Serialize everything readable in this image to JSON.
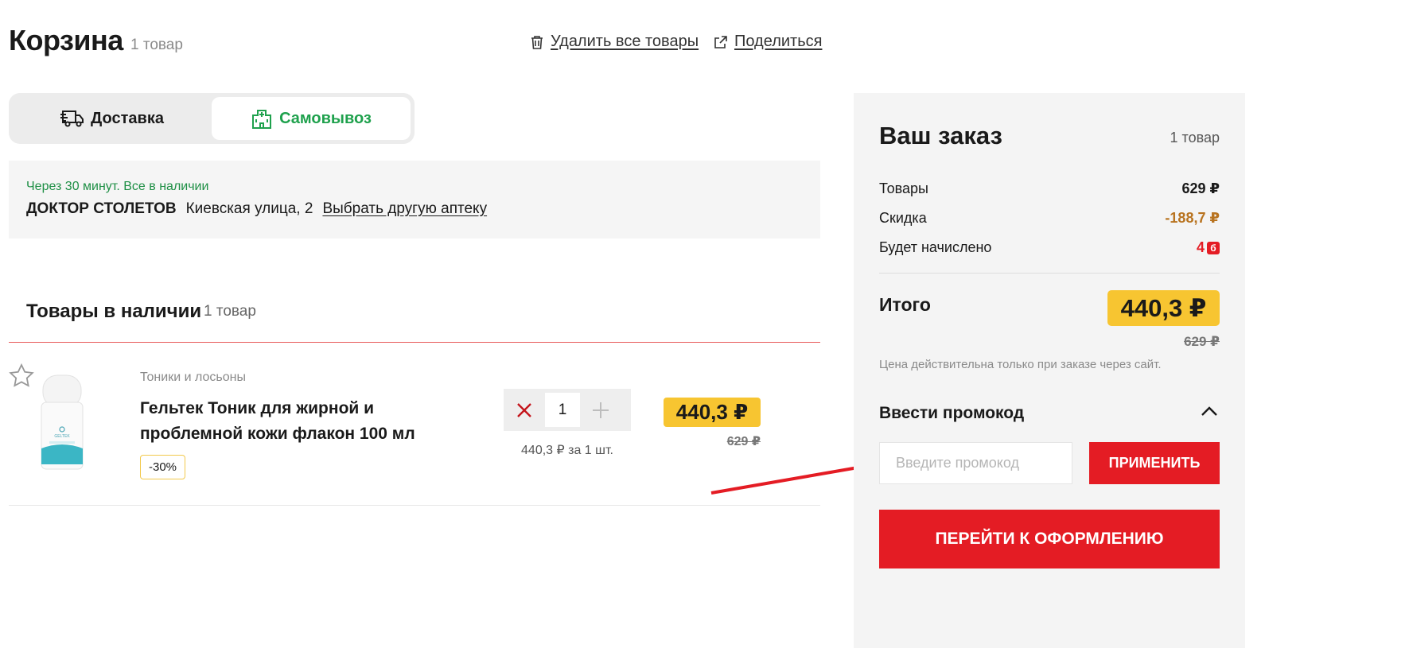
{
  "header": {
    "title": "Корзина",
    "count": "1 товар",
    "delete_all": "Удалить все товары",
    "share": "Поделиться"
  },
  "tabs": {
    "delivery": "Доставка",
    "pickup": "Самовывоз",
    "active": "pickup"
  },
  "pharmacy": {
    "note": "Через 30 минут. Все в наличии",
    "name": "ДОКТОР СТОЛЕТОВ",
    "address": "Киевская улица, 2",
    "change_link": "Выбрать другую аптеку"
  },
  "section": {
    "title": "Товары в наличии",
    "count": "1 товар"
  },
  "product": {
    "category": "Тоники и лосьоны",
    "name": "Гельтек Тоник для жирной и проблемной кожи флакон 100 мл",
    "discount_badge": "-30%",
    "quantity": "1",
    "unit_price": "440,3 ₽ за 1 шт.",
    "price": "440,3 ₽",
    "old_price": "629 ₽",
    "image_label": "GELTEK"
  },
  "summary": {
    "title": "Ваш заказ",
    "count": "1 товар",
    "goods_label": "Товары",
    "goods_value": "629 ₽",
    "discount_label": "Скидка",
    "discount_value": "-188,7 ₽",
    "bonus_label": "Будет начислено",
    "bonus_value": "4",
    "bonus_symbol": "б",
    "total_label": "Итого",
    "total_value": "440,3 ₽",
    "total_old": "629 ₽",
    "site_note": "Цена действительна только при заказе через сайт.",
    "promo_title": "Ввести промокод",
    "promo_placeholder": "Введите промокод",
    "promo_apply": "ПРИМЕНИТЬ",
    "checkout": "ПЕРЕЙТИ К ОФОРМЛЕНИЮ"
  },
  "colors": {
    "brand_red": "#e41c24",
    "price_yellow": "#f7c531",
    "pickup_green": "#1fa14d",
    "discount_brown": "#b8731f"
  },
  "icons": [
    "trash-icon",
    "share-icon",
    "delivery-truck-icon",
    "pharmacy-building-icon",
    "star-icon",
    "remove-icon",
    "plus-icon",
    "chevron-up-icon",
    "annotation-arrow-icon"
  ]
}
